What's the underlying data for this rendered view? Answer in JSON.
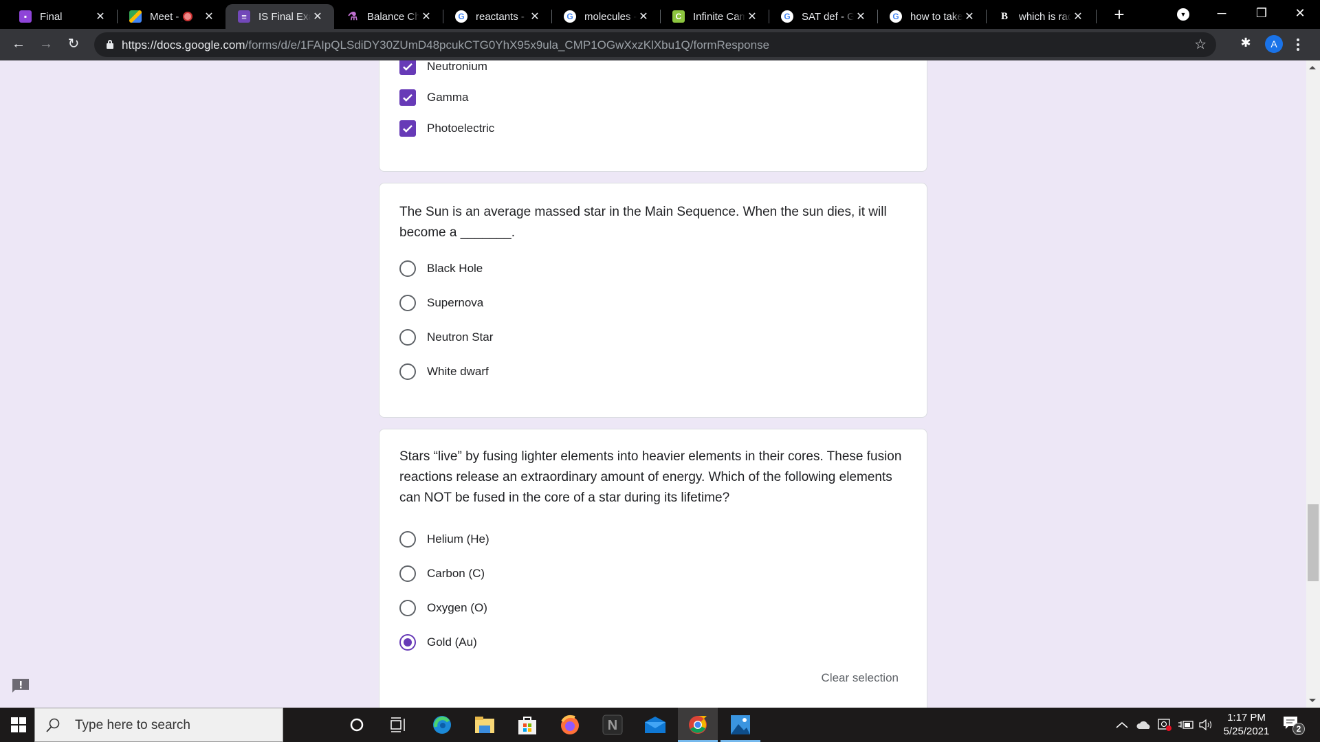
{
  "browser": {
    "tabs": [
      {
        "title": "Final",
        "favicon": "google-classroom-icon",
        "active": false
      },
      {
        "title": "Meet - j",
        "favicon": "google-meet-icon",
        "active": false,
        "recording": true
      },
      {
        "title": "IS Final Exam",
        "favicon": "google-forms-icon",
        "active": true
      },
      {
        "title": "Balance Che",
        "favicon": "flask-icon",
        "active": false
      },
      {
        "title": "reactants - G",
        "favicon": "google-icon",
        "active": false
      },
      {
        "title": "molecules -",
        "favicon": "google-icon",
        "active": false
      },
      {
        "title": "Infinite Cam",
        "favicon": "infinite-campus-icon",
        "active": false
      },
      {
        "title": "SAT def - Go",
        "favicon": "google-icon",
        "active": false
      },
      {
        "title": "how to take",
        "favicon": "google-icon",
        "active": false
      },
      {
        "title": "which is rad",
        "favicon": "brainly-icon",
        "active": false
      }
    ],
    "url_host": "https://docs.google.com",
    "url_path": "/forms/d/e/1FAIpQLSdiDY30ZUmD48pcukCTG0YhX95x9ula_CMP1OGwXxzKlXbu1Q/formResponse",
    "profile_initial": "A",
    "icons": {
      "new_tab": "+",
      "close": "✕",
      "minimize": "─",
      "restore": "❐",
      "window_close": "✕",
      "back": "←",
      "forward": "→",
      "reload": "↻",
      "star": "☆",
      "extensions": "✱"
    }
  },
  "form": {
    "q1_partial": {
      "options": [
        {
          "label": "Neutronium",
          "checked": true
        },
        {
          "label": "Gamma",
          "checked": true
        },
        {
          "label": "Photoelectric",
          "checked": true
        }
      ]
    },
    "q2": {
      "text": "The Sun is an average massed star in the Main Sequence. When the sun dies, it will become a _______.",
      "options": [
        {
          "label": "Black Hole",
          "selected": false
        },
        {
          "label": "Supernova",
          "selected": false
        },
        {
          "label": "Neutron Star",
          "selected": false
        },
        {
          "label": "White dwarf",
          "selected": false
        }
      ]
    },
    "q3": {
      "text": "Stars “live” by fusing lighter elements into heavier elements in their cores. These fusion reactions release an extraordinary amount of energy. Which of the following elements can NOT be fused in the core of a star during its lifetime?",
      "options": [
        {
          "label": "Helium (He)",
          "selected": false
        },
        {
          "label": "Carbon (C)",
          "selected": false
        },
        {
          "label": "Oxygen (O)",
          "selected": false
        },
        {
          "label": "Gold (Au)",
          "selected": true
        }
      ],
      "clear_label": "Clear selection"
    },
    "accent_color": "#673ab7",
    "background_color": "#ede7f6"
  },
  "taskbar": {
    "search_placeholder": "Type here to search",
    "apps": [
      "cortana",
      "task-view",
      "edge",
      "file-explorer",
      "microsoft-store",
      "firefox",
      "notion",
      "mail",
      "chrome",
      "photos"
    ],
    "active_app": "chrome",
    "time": "1:17 PM",
    "date": "5/25/2021",
    "notification_count": "2",
    "tray_chevron": "^"
  }
}
